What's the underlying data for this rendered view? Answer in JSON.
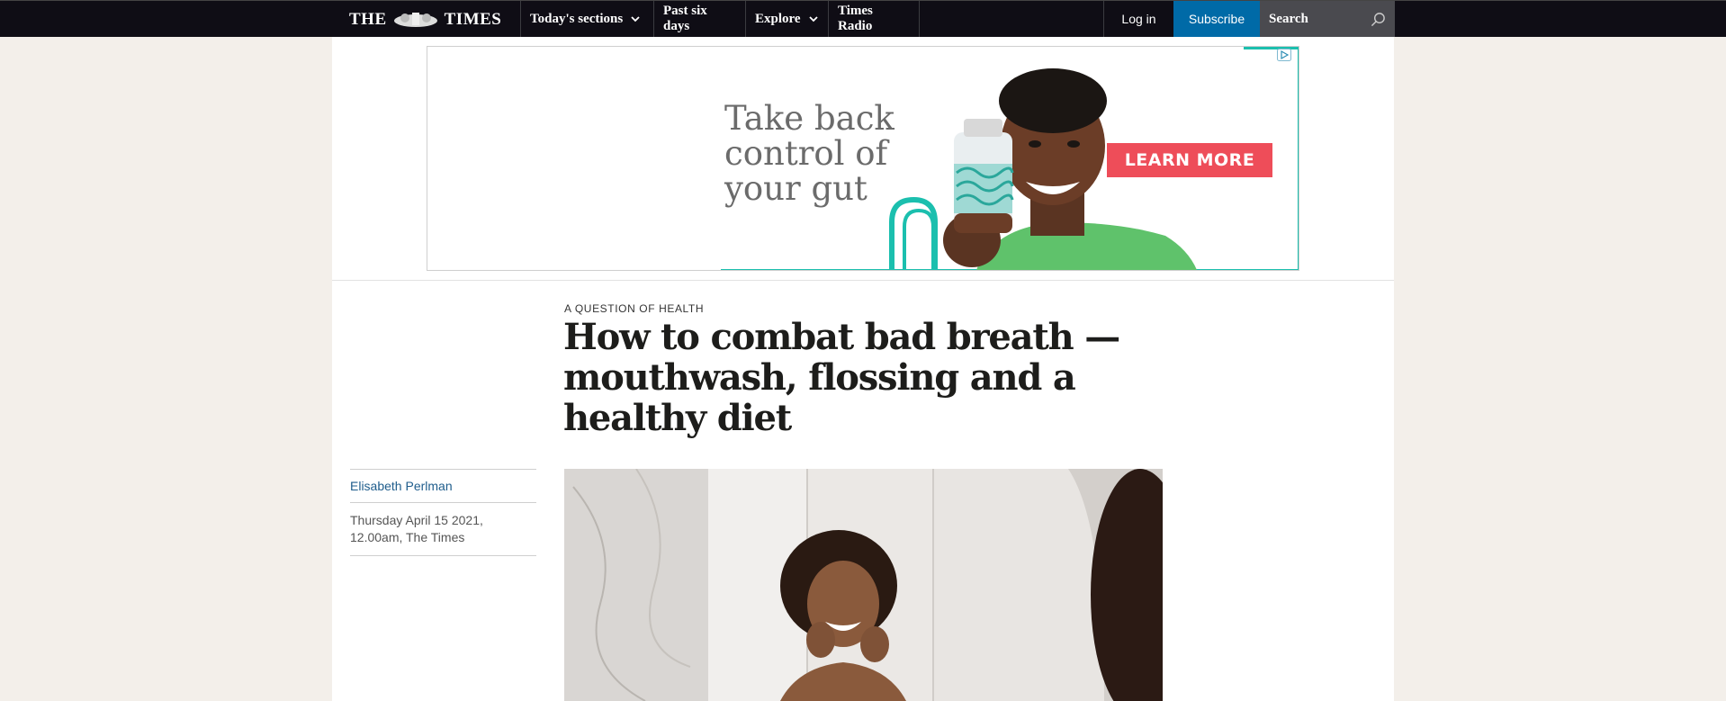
{
  "header": {
    "logo_left": "THE",
    "logo_right": "TIMES",
    "nav": [
      {
        "label": "Today's sections",
        "has_dropdown": true
      },
      {
        "label": "Past six days",
        "has_dropdown": false
      },
      {
        "label": "Explore",
        "has_dropdown": true
      },
      {
        "label": "Times Radio",
        "has_dropdown": false
      }
    ],
    "login_label": "Log in",
    "subscribe_label": "Subscribe",
    "search_placeholder": "Search"
  },
  "ad": {
    "headline": "Take back control of your gut",
    "cta": "LEARN MORE",
    "accent_color": "#1bbfae",
    "cta_color": "#ee4d59"
  },
  "article": {
    "kicker": "A QUESTION OF HEALTH",
    "headline": "How to combat bad breath — mouthwash, flossing and a healthy diet",
    "author": "Elisabeth Perlman",
    "dateline": "Thursday April 15 2021, 12.00am, The Times"
  },
  "colors": {
    "topbar": "#0f0d15",
    "subscribe": "#006aa7",
    "search_bg": "#4a4a4f",
    "page_bg": "#f3efea",
    "author_link": "#1f5d8c"
  }
}
